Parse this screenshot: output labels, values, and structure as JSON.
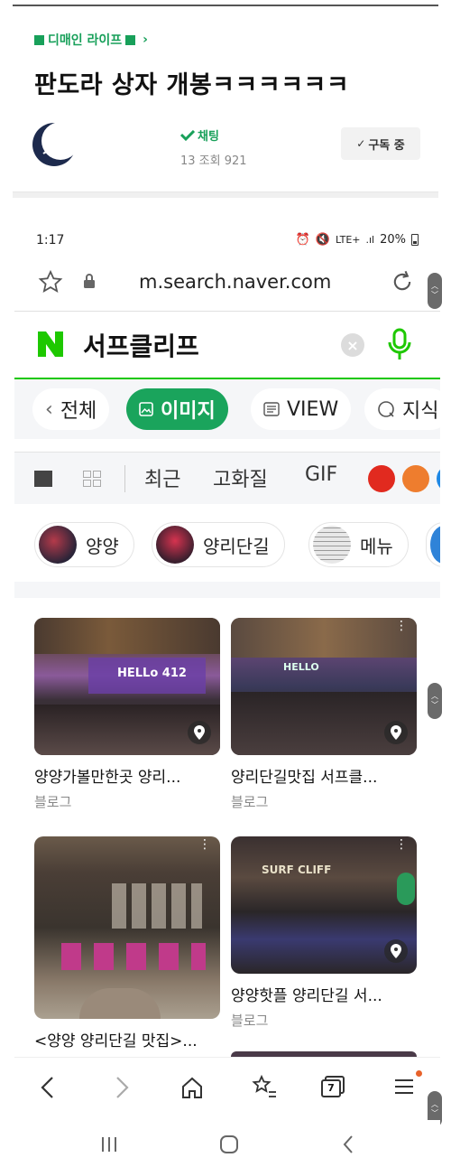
{
  "post": {
    "category": "디매인 라이프",
    "title": "판도라 상자 개봉ㅋㅋㅋㅋㅋㅋ",
    "chat_label": "채팅",
    "meta": "13  조회 921",
    "subscribe_label": "구독 중"
  },
  "status": {
    "time": "1:17",
    "network": "LTE+",
    "battery": "20%"
  },
  "browser": {
    "url": "m.search.naver.com"
  },
  "search": {
    "query": "서프클리프"
  },
  "tabs": [
    {
      "label": "전체"
    },
    {
      "label": "이미지"
    },
    {
      "label": "VIEW"
    },
    {
      "label": "지식"
    }
  ],
  "filters": {
    "recent": "최근",
    "hires": "고화질",
    "gif": "GIF",
    "colors": [
      "#e12a1f",
      "#ee7d2e",
      "#1e88e5"
    ]
  },
  "chips": [
    {
      "label": "양양"
    },
    {
      "label": "양리단길"
    },
    {
      "label": "메뉴"
    }
  ],
  "results": [
    {
      "title": "양양가볼만한곳 양리...",
      "source": "블로그",
      "sign": "HELLo 412"
    },
    {
      "title": "양리단길맛집 서프클...",
      "source": "블로그",
      "sign": "HELLO"
    },
    {
      "title": "<양양 양리단길 맛집>...",
      "source": ""
    },
    {
      "title": "양양핫플 양리단길 서...",
      "source": "블로그",
      "sign": "SURF CLIFF"
    }
  ],
  "nav": {
    "tab_count": "7"
  }
}
